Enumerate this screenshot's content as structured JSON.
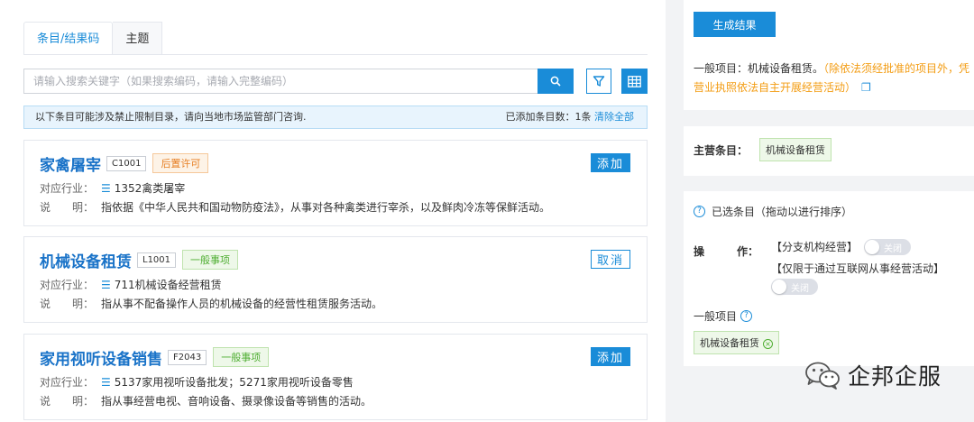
{
  "tabs": [
    {
      "label": "条目/结果码"
    },
    {
      "label": "主题"
    }
  ],
  "search": {
    "placeholder": "请输入搜索关键字（如果搜索编码，请输入完整编码）"
  },
  "notice": {
    "text": "以下条目可能涉及禁止限制目录，请向当地市场监管部门咨询.",
    "count_prefix": "已添加条目数：",
    "count": "1条",
    "clear": "清除全部"
  },
  "card_labels": {
    "industry": "对应行业：",
    "desc": "说　　明："
  },
  "cards": [
    {
      "title": "家禽屠宰",
      "code": "C1001",
      "type": "后置许可",
      "button": "添加",
      "industry": "1352禽类屠宰",
      "desc": "指依据《中华人民共和国动物防疫法》，从事对各种禽类进行宰杀，以及鲜肉冷冻等保鲜活动。"
    },
    {
      "title": "机械设备租赁",
      "code": "L1001",
      "type": "一般事项",
      "button": "取消",
      "industry": "711机械设备经营租赁",
      "desc": "指从事不配备操作人员的机械设备的经营性租赁服务活动。"
    },
    {
      "title": "家用视听设备销售",
      "code": "F2043",
      "type": "一般事项",
      "button": "添加",
      "industry": "5137家用视听设备批发；5271家用视听设备零售",
      "desc": "指从事经营电视、音响设备、摄录像设备等销售的活动。"
    }
  ],
  "result": {
    "generate_button": "生成结果",
    "line1_prefix": "一般项目：机械设备租赁。",
    "line1_orange": "（除依法须经批准的项目外，凭",
    "line2_orange": "营业执照依法自主开展经营活动）"
  },
  "main_item": {
    "label": "主营条目：",
    "tag": "机械设备租赁"
  },
  "selected": {
    "header": "已选条目（拖动以进行排序）",
    "op_label": "操　　　作：",
    "option1": "【分支机构经营】",
    "option2": "【仅限于通过互联网从事经营活动】",
    "toggle_off": "关闭",
    "general_label": "一般项目",
    "tag": "机械设备租赁"
  },
  "watermark": {
    "text": "企邦企服"
  },
  "colors": {
    "primary": "#1a8cd8",
    "orange": "#f39c12",
    "green": "#4fae32"
  }
}
